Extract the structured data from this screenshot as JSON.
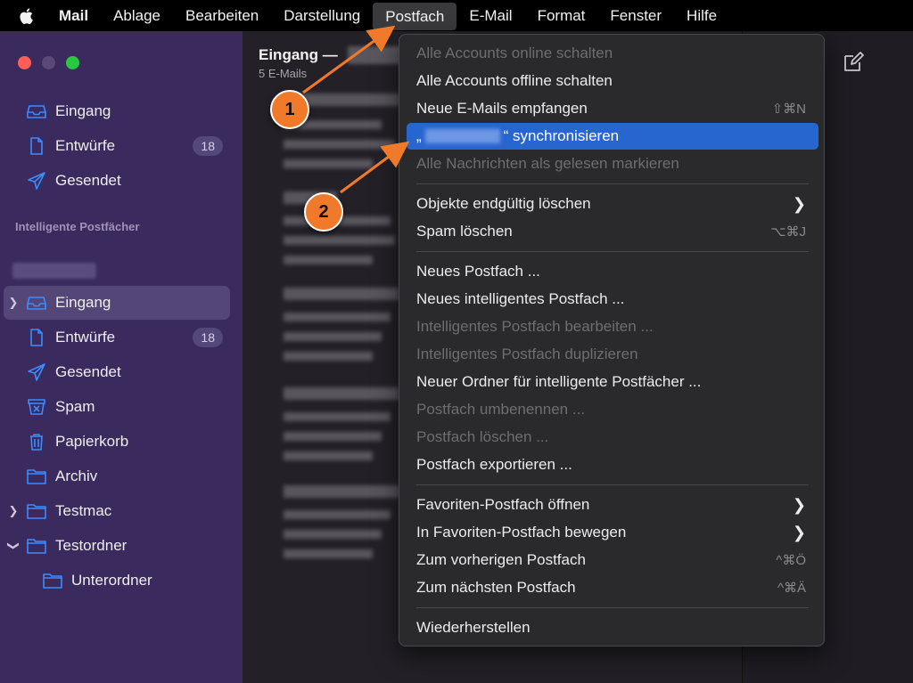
{
  "menubar": {
    "app_name": "Mail",
    "items": [
      "Ablage",
      "Bearbeiten",
      "Darstellung",
      "Postfach",
      "E-Mail",
      "Format",
      "Fenster",
      "Hilfe"
    ],
    "active_item": "Postfach"
  },
  "sidebar": {
    "favorites": [
      {
        "label": "Eingang",
        "icon": "inbox-icon"
      },
      {
        "label": "Entwürfe",
        "icon": "document-icon",
        "badge": "18"
      },
      {
        "label": "Gesendet",
        "icon": "paperplane-icon"
      }
    ],
    "section_title": "Intelligente Postfächer",
    "account_items": [
      {
        "label": "Eingang",
        "icon": "inbox-icon",
        "selected": true
      },
      {
        "label": "Entwürfe",
        "icon": "document-icon",
        "badge": "18"
      },
      {
        "label": "Gesendet",
        "icon": "paperplane-icon"
      },
      {
        "label": "Spam",
        "icon": "spam-icon"
      },
      {
        "label": "Papierkorb",
        "icon": "trash-icon"
      },
      {
        "label": "Archiv",
        "icon": "folder-icon"
      },
      {
        "label": "Testmac",
        "icon": "folder-icon"
      },
      {
        "label": "Testordner",
        "icon": "folder-icon"
      },
      {
        "label": "Unterordner",
        "icon": "folder-icon"
      }
    ]
  },
  "message_list": {
    "title": "Eingang —",
    "subtitle": "5 E-Mails"
  },
  "dropdown": {
    "items": [
      {
        "label": "Alle Accounts online schalten",
        "disabled": true
      },
      {
        "label": "Alle Accounts offline schalten"
      },
      {
        "label": "Neue E-Mails empfangen",
        "shortcut": "⇧⌘N"
      },
      {
        "label_prefix": "„",
        "label_suffix": "“ synchronisieren",
        "highlight": true
      },
      {
        "label": "Alle Nachrichten als gelesen markieren",
        "disabled": true
      },
      {
        "label": "Objekte endgültig löschen",
        "submenu": true
      },
      {
        "label": "Spam löschen",
        "shortcut": "⌥⌘J"
      },
      {
        "label": "Neues Postfach ..."
      },
      {
        "label": "Neues intelligentes Postfach ..."
      },
      {
        "label": "Intelligentes Postfach bearbeiten ...",
        "disabled": true
      },
      {
        "label": "Intelligentes Postfach duplizieren",
        "disabled": true
      },
      {
        "label": "Neuer Ordner für intelligente Postfächer ..."
      },
      {
        "label": "Postfach umbenennen ...",
        "disabled": true
      },
      {
        "label": "Postfach löschen ...",
        "disabled": true
      },
      {
        "label": "Postfach exportieren ..."
      },
      {
        "label": "Favoriten-Postfach öffnen",
        "submenu": true
      },
      {
        "label": "In Favoriten-Postfach bewegen",
        "submenu": true
      },
      {
        "label": "Zum vorherigen Postfach",
        "shortcut": "^⌘Ö"
      },
      {
        "label": "Zum nächsten Postfach",
        "shortcut": "^⌘Ä"
      },
      {
        "label": "Wiederherstellen"
      }
    ]
  },
  "annotations": {
    "step1": "1",
    "step2": "2",
    "color": "#f07a2a"
  },
  "colors": {
    "sidebar_bg": "#3a2a5e",
    "accent": "#3b8cff",
    "highlight": "#2866cf"
  }
}
